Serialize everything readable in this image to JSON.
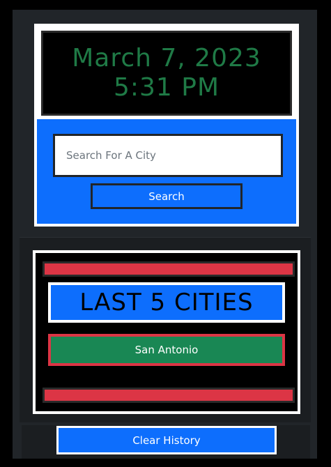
{
  "clock": {
    "date": "March 7, 2023",
    "time": "5:31 PM"
  },
  "search": {
    "placeholder": "Search For A City",
    "value": "",
    "button_label": "Search"
  },
  "history": {
    "title": "LAST 5 CITIES",
    "cities": [
      "San Antonio"
    ]
  },
  "actions": {
    "clear_label": "Clear History"
  },
  "colors": {
    "primary": "#0d6efd",
    "danger": "#dc3545",
    "success": "#198754",
    "clock_text": "#1f7a46",
    "panel": "#212529"
  }
}
